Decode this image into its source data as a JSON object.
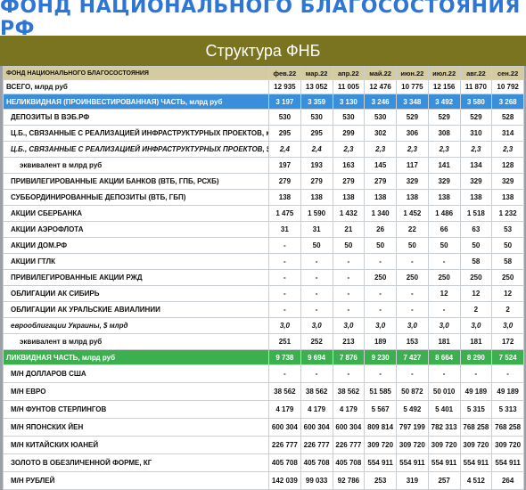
{
  "title": "ФОНД НАЦИОНАЛЬНОГО БЛАГОСОСТОЯНИЯ РФ",
  "subtitle": "Структура ФНБ",
  "table": {
    "header": {
      "label": "ФОНД НАЦИОНАЛЬНОГО БЛАГОСОСТОЯНИЯ",
      "months": [
        "фев.22",
        "мар.22",
        "апр.22",
        "май.22",
        "июн.22",
        "июл.22",
        "авг.22",
        "сен.22"
      ]
    },
    "total": {
      "label": "ВСЕГО, млрд руб",
      "values": [
        "12 935",
        "13 052",
        "11 005",
        "12 476",
        "10 775",
        "12 156",
        "11 870",
        "10 792"
      ]
    },
    "nonliquid": {
      "label": "НЕЛИКВИДНАЯ (ПРОИНВЕСТИРОВАННАЯ) ЧАСТЬ, млрд руб",
      "values": [
        "3 197",
        "3 359",
        "3 130",
        "3 246",
        "3 348",
        "3 492",
        "3 580",
        "3 268"
      ]
    },
    "nonliquid_rows": [
      {
        "label": "ДЕПОЗИТЫ В ВЭБ.РФ",
        "values": [
          "530",
          "530",
          "530",
          "530",
          "529",
          "529",
          "529",
          "528"
        ]
      },
      {
        "label": "Ц.Б., СВЯЗАННЫЕ С РЕАЛИЗАЦИЕЙ ИНФРАСТРУКТУРНЫХ ПРОЕКТОВ, млрд руб",
        "values": [
          "295",
          "295",
          "299",
          "302",
          "306",
          "308",
          "310",
          "314"
        ]
      },
      {
        "label": "Ц.Б., СВЯЗАННЫЕ С РЕАЛИЗАЦИЕЙ ИНФРАСТРУКТУРНЫХ ПРОЕКТОВ, $ млрд",
        "values": [
          "2,4",
          "2,4",
          "2,3",
          "2,3",
          "2,3",
          "2,3",
          "2,3",
          "2,3"
        ]
      },
      {
        "label": "эквивалент в млрд руб",
        "values": [
          "197",
          "193",
          "163",
          "145",
          "117",
          "141",
          "134",
          "128"
        ]
      },
      {
        "label": "ПРИВИЛЕГИРОВАННЫЕ АКЦИИ БАНКОВ (ВТБ, ГПБ, РСХБ)",
        "values": [
          "279",
          "279",
          "279",
          "279",
          "329",
          "329",
          "329",
          "329"
        ]
      },
      {
        "label": "СУББОРДИНИРОВАННЫЕ ДЕПОЗИТЫ (ВТБ, ГБП)",
        "values": [
          "138",
          "138",
          "138",
          "138",
          "138",
          "138",
          "138",
          "138"
        ]
      },
      {
        "label": "АКЦИИ СБЕРБАНКА",
        "values": [
          "1 475",
          "1 590",
          "1 432",
          "1 340",
          "1 452",
          "1 486",
          "1 518",
          "1 232"
        ]
      },
      {
        "label": "АКЦИИ АЭРОФЛОТА",
        "values": [
          "31",
          "31",
          "21",
          "26",
          "22",
          "66",
          "63",
          "53"
        ]
      },
      {
        "label": "АКЦИИ ДОМ.РФ",
        "values": [
          "-",
          "50",
          "50",
          "50",
          "50",
          "50",
          "50",
          "50"
        ]
      },
      {
        "label": "АКЦИИ ГТЛК",
        "values": [
          "-",
          "-",
          "-",
          "-",
          "-",
          "-",
          "58",
          "58"
        ]
      },
      {
        "label": "ПРИВИЛЕГИРОВАННЫЕ АКЦИИ РЖД",
        "values": [
          "-",
          "-",
          "-",
          "250",
          "250",
          "250",
          "250",
          "250"
        ]
      },
      {
        "label": "ОБЛИГАЦИИ АК СИБИРЬ",
        "values": [
          "-",
          "-",
          "-",
          "-",
          "-",
          "12",
          "12",
          "12"
        ]
      },
      {
        "label": "ОБЛИГАЦИИ АК УРАЛЬСКИЕ АВИАЛИНИИ",
        "values": [
          "-",
          "-",
          "-",
          "-",
          "-",
          "-",
          "2",
          "2"
        ]
      },
      {
        "label": "еврооблигации Украины, $ млрд",
        "values": [
          "3,0",
          "3,0",
          "3,0",
          "3,0",
          "3,0",
          "3,0",
          "3,0",
          "3,0"
        ]
      },
      {
        "label": "эквивалент в млрд руб",
        "values": [
          "251",
          "252",
          "213",
          "189",
          "153",
          "181",
          "181",
          "172"
        ]
      }
    ],
    "liquid": {
      "label": "ЛИКВИДНАЯ ЧАСТЬ, млрд руб",
      "values": [
        "9 738",
        "9 694",
        "7 876",
        "9 230",
        "7 427",
        "8 664",
        "8 290",
        "7 524"
      ]
    },
    "liquid_rows": [
      {
        "label": "М/Н ДОЛЛАРОВ США",
        "values": [
          "-",
          "-",
          "-",
          "-",
          "-",
          "-",
          "-",
          "-"
        ]
      },
      {
        "label": "М/Н ЕВРО",
        "values": [
          "38 562",
          "38 562",
          "38 562",
          "51 585",
          "50 872",
          "50 010",
          "49 189",
          "49 189"
        ]
      },
      {
        "label": "М/Н ФУНТОВ СТЕРЛИНГОВ",
        "values": [
          "4 179",
          "4 179",
          "4 179",
          "5 567",
          "5 492",
          "5 401",
          "5 315",
          "5 313"
        ]
      },
      {
        "label": "М/Н ЯПОНСКИХ ЙЕН",
        "values": [
          "600 304",
          "600 304",
          "600 304",
          "809 814",
          "797 199",
          "782 313",
          "768 258",
          "768 258"
        ]
      },
      {
        "label": "М/Н КИТАЙСКИХ ЮАНЕЙ",
        "values": [
          "226 777",
          "226 777",
          "226 777",
          "309 720",
          "309 720",
          "309 720",
          "309 720",
          "309 720"
        ]
      },
      {
        "label": "ЗОЛОТО В ОБЕЗЛИЧЕННОЙ ФОРМЕ, КГ",
        "values": [
          "405 708",
          "405 708",
          "405 708",
          "554 911",
          "554 911",
          "554 911",
          "554 911",
          "554 911"
        ]
      },
      {
        "label": "М/Н РУБЛЕЙ",
        "values": [
          "142 039",
          "99 033",
          "92 786",
          "253",
          "319",
          "257",
          "4 512",
          "264"
        ]
      }
    ]
  }
}
